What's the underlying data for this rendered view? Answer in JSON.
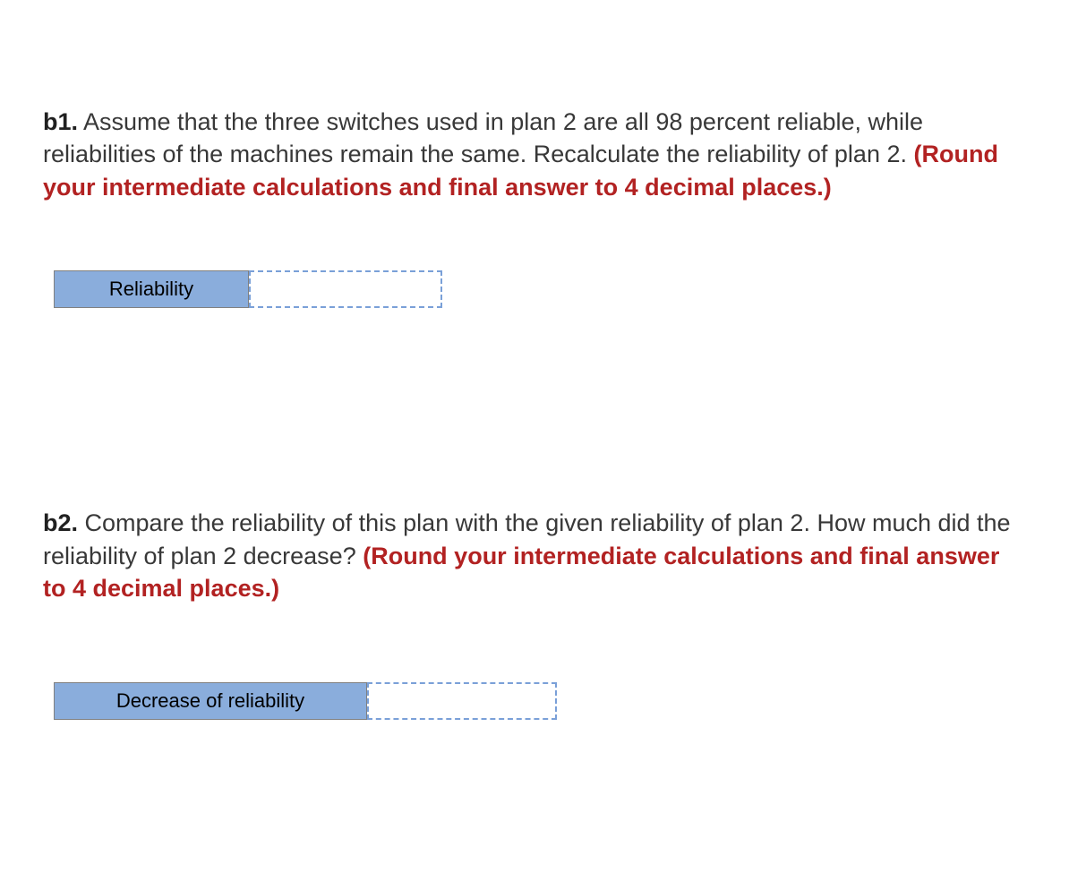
{
  "questions": {
    "b1": {
      "label": "b1.",
      "text": " Assume that the three switches used in plan 2 are all 98 percent reliable, while reliabilities of the machines remain the same. Recalculate the reliability of plan 2. ",
      "instruction": "(Round your intermediate calculations and final answer to 4 decimal places.)",
      "answer_label": "Reliability",
      "answer_value": ""
    },
    "b2": {
      "label": "b2.",
      "text": " Compare the reliability of this plan with the given reliability of plan 2. How much did the reliability of plan 2 decrease? ",
      "instruction": "(Round your intermediate calculations and final answer to 4 decimal places.)",
      "answer_label": "Decrease of reliability",
      "answer_value": ""
    }
  }
}
